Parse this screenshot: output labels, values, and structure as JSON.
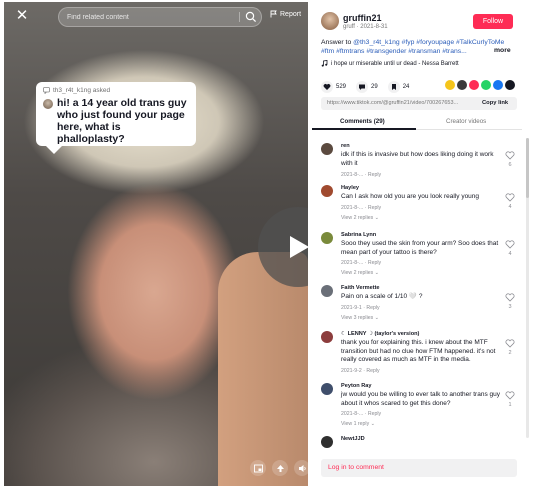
{
  "video": {
    "search_placeholder": "Find related content",
    "report_label": "Report",
    "question": {
      "asker": "th3_r4t_k1ng asked",
      "text": "hi! a 14 year old trans guy who just found your page here, what is phalloplasty?"
    }
  },
  "author": {
    "name": "gruffin21",
    "meta": "gruff · 2021-8-31",
    "follow_label": "Follow",
    "desc_prefix": "Answer to ",
    "desc_tags": "@th3_r4t_k1ng #fyp #foryoupage #TalkCurlyToMe #ftm #ftmtrans #transgender #transman #trans...",
    "more_label": "more",
    "music": "i hope ur miserable until ur dead - Nessa Barrett"
  },
  "stats": {
    "likes": "529",
    "comments": "29",
    "saves": "24"
  },
  "share_colors": [
    "#f5c51b",
    "#3a3a3a",
    "#fe2c55",
    "#25d366",
    "#1877f2",
    "#161823"
  ],
  "link": {
    "url": "https://www.tiktok.com/@gruffin21/video/700267653...",
    "copy_label": "Copy link"
  },
  "tabs": {
    "comments": "Comments (29)",
    "creator": "Creator videos"
  },
  "comments": [
    {
      "name": "ren",
      "text": "idk if this is invasive but how does liking doing it work with it",
      "meta": "2021-8-...",
      "reply": "Reply",
      "likes": "6",
      "avatar": "#5b4a3f"
    },
    {
      "name": "Hayley",
      "text": "Can I ask how old you are you look really young",
      "meta": "2021-8-...",
      "reply": "Reply",
      "replies": "View 2 replies",
      "likes": "4",
      "avatar": "#a04a2f"
    },
    {
      "name": "Sabrina Lynn",
      "text": "Sooo they used the skin from your arm? Soo does that mean part of your tattoo is there?",
      "meta": "2021-8-...",
      "reply": "Reply",
      "replies": "View 2 replies",
      "likes": "4",
      "avatar": "#7a8a3b"
    },
    {
      "name": "Faith Vermette",
      "text": "Pain on a scale of 1/10 🤍 ?",
      "meta": "2021-9-1",
      "reply": "Reply",
      "replies": "View 3 replies",
      "likes": "3",
      "avatar": "#6a6f78"
    },
    {
      "name": "☾ LENNY ☽ (taylor's version)",
      "text": "thank you for explaining this. i knew about the MTF transition but had no clue how FTM happened. it's not really covered as much as MTF in the media.",
      "meta": "2021-9-2",
      "reply": "Reply",
      "likes": "2",
      "avatar": "#8c3d3d"
    },
    {
      "name": "Peyton Ray",
      "text": "jw would you be willing to ever talk to another trans guy about it whos scared to get this done?",
      "meta": "2021-8-...",
      "reply": "Reply",
      "replies": "View 1 reply",
      "likes": "1",
      "avatar": "#3f4e6b"
    },
    {
      "name": "NewtJJD",
      "avatar": "#2f2f2f"
    }
  ],
  "login_label": "Log in to comment"
}
